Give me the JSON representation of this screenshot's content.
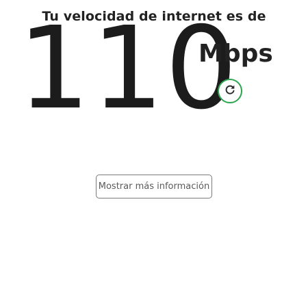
{
  "header": {
    "title": "Tu velocidad de internet es de"
  },
  "speed": {
    "value": "110",
    "unit": "Mbps"
  },
  "actions": {
    "refresh_icon": "refresh-icon",
    "refresh_color": "#2da44e",
    "more_info_label": "Mostrar más información"
  }
}
